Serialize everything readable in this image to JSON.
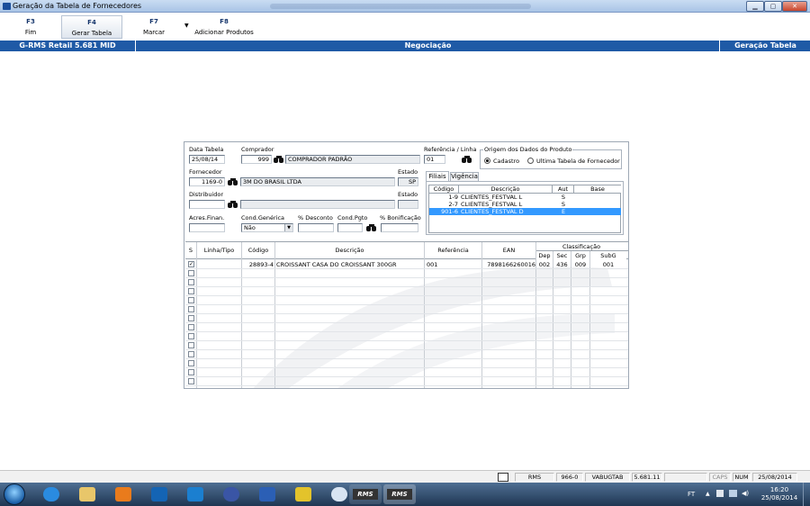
{
  "window": {
    "title": "Geração da Tabela de Fornecedores"
  },
  "toolbar": {
    "buttons": [
      {
        "key": "F3",
        "label": "Fim"
      },
      {
        "key": "F4",
        "label": "Gerar Tabela"
      },
      {
        "key": "F7",
        "label": "Marcar"
      },
      {
        "key": "F8",
        "label": "Adicionar Produtos"
      }
    ]
  },
  "header": {
    "left": "G-RMS Retail 5.681 MID",
    "center": "Negociação",
    "right": "Geração Tabela"
  },
  "form": {
    "data_tabela_label": "Data Tabela",
    "data_tabela": "25/08/14",
    "comprador_label": "Comprador",
    "comprador_cod": "999",
    "comprador_nome": "COMPRADOR PADRÃO",
    "referencia_label": "Referência / Linha",
    "referencia": "01",
    "origem_label": "Origem dos Dados do Produto",
    "origem_opt1": "Cadastro",
    "origem_opt2": "Ultima Tabela de Fornecedor",
    "fornecedor_label": "Fornecedor",
    "fornecedor_cod": "1169-0",
    "fornecedor_nome": "3M DO BRASIL LTDA",
    "estado_label": "Estado",
    "fornecedor_estado": "SP",
    "distribuidor_label": "Distribuidor",
    "distribuidor_cod": "",
    "distribuidor_nome": "",
    "estado2_label": "Estado",
    "distribuidor_estado": "",
    "acres_label": "Acres.Finan.",
    "acres": "",
    "cond_gen_label": "Cond.Genérica",
    "cond_gen": "Não",
    "desconto_label": "% Desconto",
    "desconto": "",
    "cond_pgto_label": "Cond.Pgto",
    "cond_pgto": "",
    "bonif_label": "% Bonificação",
    "bonif": ""
  },
  "filiais": {
    "tabs": [
      "Filiais",
      "Vigência"
    ],
    "columns": [
      "Código",
      "Descrição",
      "Aut",
      "Base"
    ],
    "rows": [
      {
        "codigo": "1-9",
        "descricao": "CLIENTES_FESTVAL L",
        "aut": "S",
        "base": "",
        "selected": false
      },
      {
        "codigo": "2-7",
        "descricao": "CLIENTES_FESTVAL L",
        "aut": "S",
        "base": "",
        "selected": false
      },
      {
        "codigo": "901-6",
        "descricao": "CLIENTES_FESTVAL D",
        "aut": "E",
        "base": "",
        "selected": true
      }
    ]
  },
  "produtos": {
    "columns": {
      "s": "S",
      "linha": "Linha/Tipo",
      "codigo": "Código",
      "descricao": "Descrição",
      "referencia": "Referência",
      "ean": "EAN",
      "classificacao": "Classificação",
      "dep": "Dep",
      "sec": "Sec",
      "grp": "Grp",
      "subg": "SubG"
    },
    "rows": [
      {
        "checked": true,
        "linha": "",
        "codigo": "28893-4",
        "descricao": "CROISSANT CASA DO CROISSANT 300GR",
        "referencia": "001",
        "ean": "7898166260016",
        "dep": "002",
        "sec": "436",
        "grp": "009",
        "subg": "001"
      }
    ],
    "empty_rows": 13
  },
  "statusbar": {
    "sistema": "RMS",
    "codigo": "966-0",
    "programa": "VABUGTAB",
    "versao": "5.681.11",
    "caps": "CAPS",
    "num": "NUM",
    "data": "25/08/2014"
  },
  "taskbar": {
    "lang": "FT",
    "time": "16:20",
    "date": "25/08/2014",
    "app_label_1": "RMS",
    "app_label_2": "RMS"
  },
  "colors": {
    "header_blue": "#1f5aa6",
    "selection_blue": "#3399ff"
  }
}
